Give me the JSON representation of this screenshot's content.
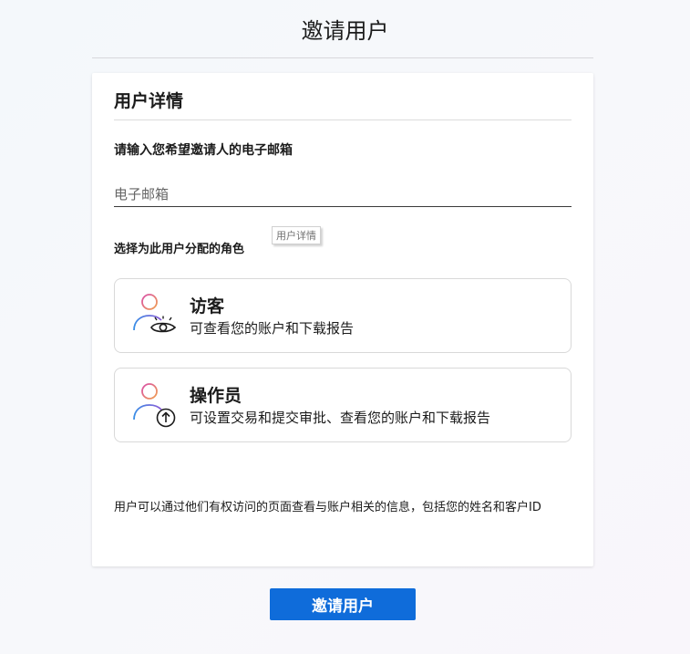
{
  "page": {
    "title": "邀请用户"
  },
  "card": {
    "title": "用户详情",
    "email_prompt": "请输入您希望邀请人的电子邮箱",
    "email": {
      "value": "",
      "placeholder": "电子邮箱"
    },
    "role_prompt": "选择为此用户分配的角色",
    "tooltip": "用户详情",
    "roles": [
      {
        "name": "访客",
        "description": "可查看您的账户和下载报告",
        "icon": "person-eye-icon"
      },
      {
        "name": "操作员",
        "description": "可设置交易和提交审批、查看您的账户和下载报告",
        "icon": "person-upload-icon"
      }
    ],
    "footnote": "用户可以通过他们有权访问的页面查看与账户相关的信息，包括您的姓名和客户ID"
  },
  "actions": {
    "invite_label": "邀请用户"
  },
  "colors": {
    "primary": "#0f6cda",
    "icon_gradient_start": "#d94fa8",
    "icon_gradient_end": "#f0a050",
    "icon_body_start": "#6a5acd",
    "icon_body_end": "#3a8ee6"
  }
}
